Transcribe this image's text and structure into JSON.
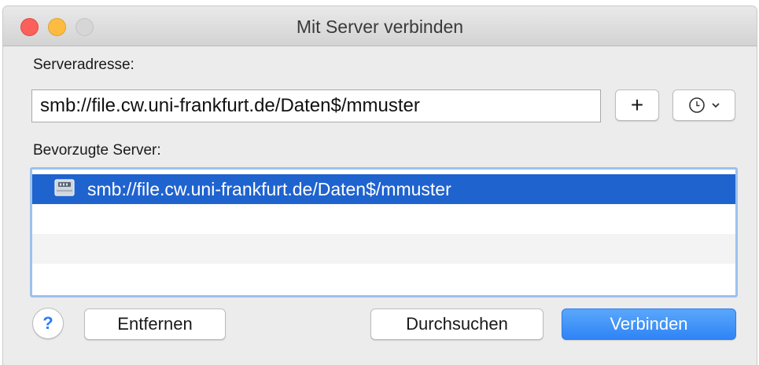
{
  "window": {
    "title": "Mit Server verbinden"
  },
  "server_address": {
    "label": "Serveradresse:",
    "value": "smb://file.cw.uni-frankfurt.de/Daten$/mmuster",
    "add_label": "+",
    "history_icon": "clock-chevron-icon"
  },
  "favorites": {
    "label": "Bevorzugte Server:",
    "items": [
      {
        "label": "smb://file.cw.uni-frankfurt.de/Daten$/mmuster",
        "icon": "server-icon",
        "selected": true
      }
    ]
  },
  "footer": {
    "help_label": "?",
    "remove_label": "Entfernen",
    "browse_label": "Durchsuchen",
    "connect_label": "Verbinden"
  },
  "colors": {
    "selection": "#1f63cf",
    "primary_button": "#3b8ef8",
    "close": "#fc605b",
    "minimize": "#fdbc40"
  }
}
